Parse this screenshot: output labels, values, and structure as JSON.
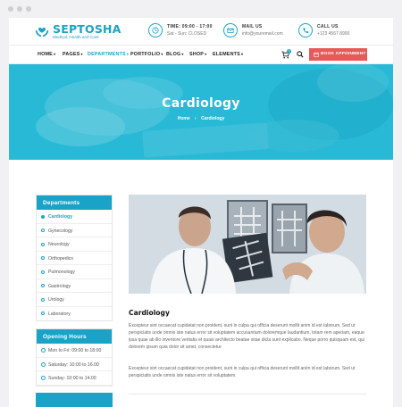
{
  "brand": {
    "name": "SEPTOSHA",
    "tagline": "Medical, Health and Care"
  },
  "contact": [
    {
      "icon": "clock-icon",
      "title": "TIME: 09:00 - 17:00",
      "sub": "Sat - Sun: CLOSED"
    },
    {
      "icon": "mail-icon",
      "title": "MAIL US",
      "sub": "info@youremail.com"
    },
    {
      "icon": "phone-icon",
      "title": "CALL US",
      "sub": "+123 4567 8900"
    }
  ],
  "nav": {
    "items": [
      "HOME",
      "PAGES",
      "DEPARTMENTS",
      "PORTFOLIO",
      "BLOG",
      "SHOP",
      "ELEMENTS"
    ],
    "active": "DEPARTMENTS",
    "cart_count": "0",
    "book_label": "BOOK APPOINMENT"
  },
  "hero": {
    "title": "Cardiology",
    "crumb_home": "Home",
    "crumb_sep": "›",
    "crumb_current": "Cardiology"
  },
  "departments": {
    "title": "Departments",
    "items": [
      "Cardiology",
      "Gynecology",
      "Neurology",
      "Orthopedics",
      "Pulmonology",
      "Gastrology",
      "Urology",
      "Laboratory"
    ],
    "active": "Cardiology"
  },
  "hours": {
    "title": "Opening Hours",
    "items": [
      "Mon to Fri: 09:00 to 18:00",
      "Saturday: 10:00 to 16.00",
      "Sunday: 10:00 to 14.00"
    ]
  },
  "main": {
    "heading": "Cardiology",
    "paragraphs": [
      "Excepteur sint occaecat cupidatat non proident, sunt in culpa qui officia deserunt mollit anim id est laborum. Sed ut perspiciatis unde omnis iste natus error sit voluptatem accusantium doloremque laudantium, totam rem aperiam, eaque ipsa quae ab illo inventore veritatis et quasi architecto beatae vitae dicta sunt explicabo. Neque porro quisquam est, qui dolorem ipsum quia dolor sit amet, consectetur.",
      "Excepteur sint occaecat cupidatat non proident, sunt in culpa qui officia deserunt mollit anim id est laborum. Sed ut perspiciatis unde omnis iste natus error sit voluptatem."
    ]
  },
  "colors": {
    "accent": "#1aa3c6",
    "hero": "#26b8d4",
    "button": "#e85959"
  }
}
